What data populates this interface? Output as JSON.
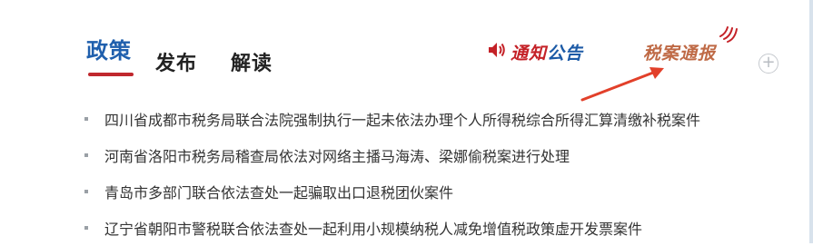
{
  "tabs": [
    {
      "label": "政策",
      "active": true
    },
    {
      "label": "发布",
      "active": false
    },
    {
      "label": "解读",
      "active": false
    }
  ],
  "links": {
    "notice_label_red": "通知",
    "notice_label_blue": "公告",
    "case_label": "税案通报"
  },
  "plus_label": "+",
  "news": [
    {
      "title": "四川省成都市税务局联合法院强制执行一起未依法办理个人所得税综合所得汇算清缴补税案件"
    },
    {
      "title": "河南省洛阳市税务局稽查局依法对网络主播马海涛、梁娜偷税案进行处理"
    },
    {
      "title": "青岛市多部门联合依法查处一起骗取出口退税团伙案件"
    },
    {
      "title": "辽宁省朝阳市警税联合依法查处一起利用小规模纳税人减免增值税政策虚开发票案件"
    }
  ],
  "colors": {
    "accent_blue": "#1f5fad",
    "accent_red": "#c0282d",
    "case_orange": "#bf6a46"
  },
  "icons": [
    "speaker-icon",
    "signal-icon",
    "plus-icon",
    "arrow-annotation"
  ]
}
